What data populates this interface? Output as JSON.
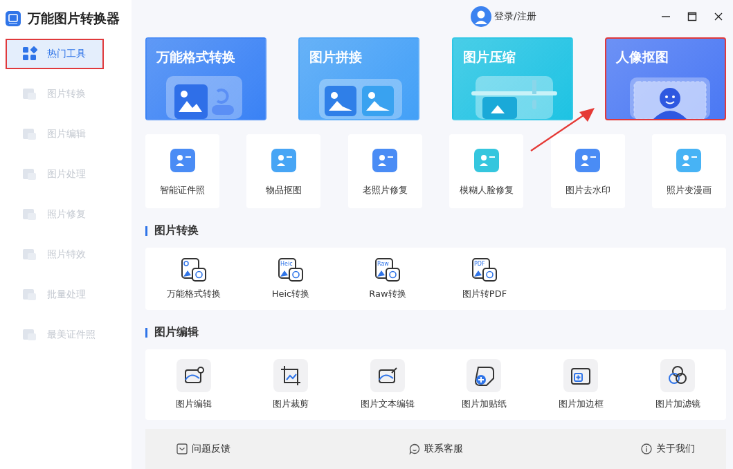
{
  "app": {
    "title": "万能图片转换器"
  },
  "sidebar": {
    "items": [
      {
        "label": "热门工具",
        "selected": true,
        "highlighted": true
      },
      {
        "label": "图片转换",
        "selected": false,
        "highlighted": false
      },
      {
        "label": "图片编辑",
        "selected": false,
        "highlighted": false
      },
      {
        "label": "图片处理",
        "selected": false,
        "highlighted": false
      },
      {
        "label": "照片修复",
        "selected": false,
        "highlighted": false
      },
      {
        "label": "照片特效",
        "selected": false,
        "highlighted": false
      },
      {
        "label": "批量处理",
        "selected": false,
        "highlighted": false
      },
      {
        "label": "最美证件照",
        "selected": false,
        "highlighted": false
      }
    ]
  },
  "account": {
    "label": "登录/注册"
  },
  "banners": [
    {
      "title": "万能格式转换",
      "color": "#3a82f5",
      "kind": "convert",
      "highlighted": false
    },
    {
      "title": "图片拼接",
      "color": "#43a0f7",
      "kind": "stitch",
      "highlighted": false
    },
    {
      "title": "图片压缩",
      "color": "#1ec3e3",
      "kind": "compress",
      "highlighted": false
    },
    {
      "title": "人像抠图",
      "color": "#4a78f4",
      "kind": "portrait",
      "highlighted": true
    }
  ],
  "hot_tools": [
    {
      "label": "智能证件照",
      "color": "#4a8cf5"
    },
    {
      "label": "物品抠图",
      "color": "#47a5f5"
    },
    {
      "label": "老照片修复",
      "color": "#4a8cf5"
    },
    {
      "label": "模糊人脸修复",
      "color": "#35c6de"
    },
    {
      "label": "图片去水印",
      "color": "#4a8cf5"
    },
    {
      "label": "照片变漫画",
      "color": "#47b3f5"
    }
  ],
  "sections": [
    {
      "title": "图片转换",
      "items": [
        {
          "label": "万能格式转换"
        },
        {
          "label": "Heic转换",
          "badge": "Heic"
        },
        {
          "label": "Raw转换",
          "badge": "Raw"
        },
        {
          "label": "图片转PDF",
          "badge": "PDF"
        }
      ]
    },
    {
      "title": "图片编辑",
      "items": [
        {
          "label": "图片编辑",
          "kind": "gear"
        },
        {
          "label": "图片裁剪",
          "kind": "crop"
        },
        {
          "label": "图片文本编辑",
          "kind": "pen"
        },
        {
          "label": "图片加贴纸",
          "kind": "sticker"
        },
        {
          "label": "图片加边框",
          "kind": "frame"
        },
        {
          "label": "图片加滤镜",
          "kind": "filter"
        }
      ]
    }
  ],
  "footer": [
    {
      "label": "问题反馈",
      "kind": "feedback"
    },
    {
      "label": "联系客服",
      "kind": "chat"
    },
    {
      "label": "关于我们",
      "kind": "info"
    }
  ]
}
